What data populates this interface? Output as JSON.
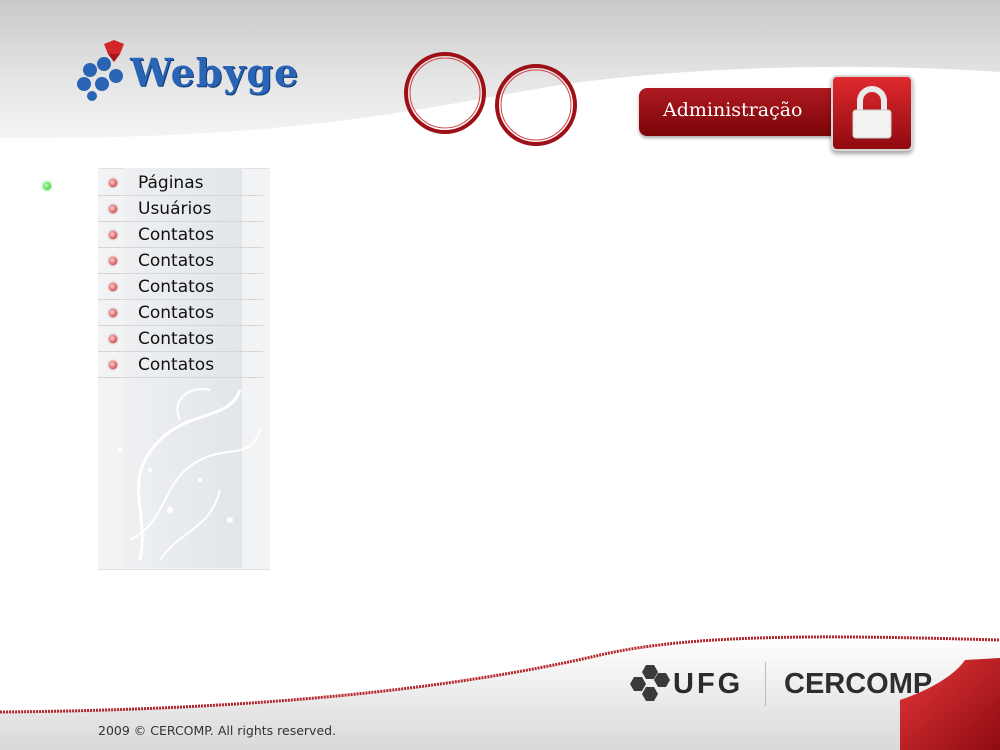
{
  "brand": {
    "name": "Webyge",
    "logo_icon": "gem-hexagon-logo"
  },
  "header": {
    "admin_label": "Administração",
    "lock_icon": "lock-icon"
  },
  "sidebar": {
    "items": [
      {
        "label": "Páginas"
      },
      {
        "label": "Usuários"
      },
      {
        "label": "Contatos"
      },
      {
        "label": "Contatos"
      },
      {
        "label": "Contatos"
      },
      {
        "label": "Contatos"
      },
      {
        "label": "Contatos"
      },
      {
        "label": "Contatos"
      }
    ]
  },
  "partners": {
    "ufg": "UFG",
    "cercomp": "CERCOMP"
  },
  "footer": {
    "copyright": "2009 © CERCOMP. All rights reserved."
  },
  "colors": {
    "accent_red": "#b01a22",
    "brand_blue": "#2a64b4",
    "status_green": "#2fb82a"
  }
}
